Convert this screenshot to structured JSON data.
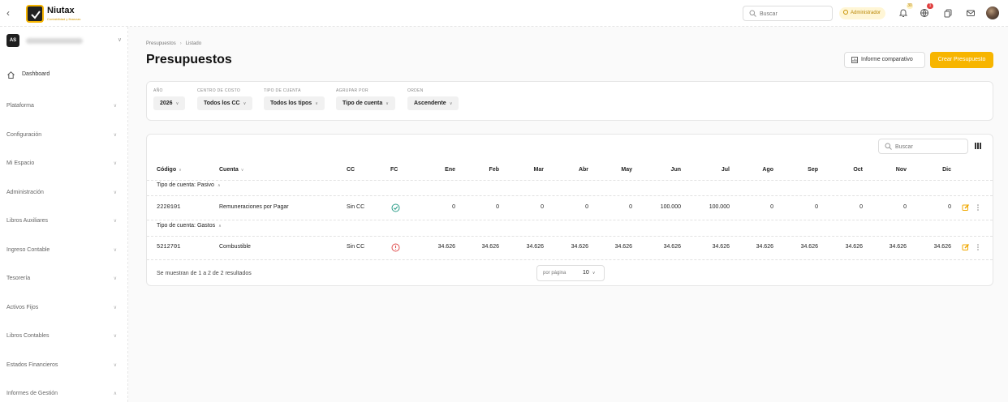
{
  "brand": {
    "name": "Niutax",
    "tagline": "Contabilidad y finanzas"
  },
  "topbar": {
    "search_placeholder": "Buscar",
    "role": "Administrador",
    "notifications_count": "30",
    "alerts_count": "1"
  },
  "sidebar": {
    "company_abbr": "AS",
    "dashboard": "Dashboard",
    "items": [
      {
        "label": "Plataforma",
        "chevron": "∨"
      },
      {
        "label": "Configuración",
        "chevron": "∨"
      },
      {
        "label": "Mi Espacio",
        "chevron": "∨"
      },
      {
        "label": "Administración",
        "chevron": "∨"
      },
      {
        "label": "Libros Auxiliares",
        "chevron": "∨"
      },
      {
        "label": "Ingreso Contable",
        "chevron": "∨"
      },
      {
        "label": "Tesorería",
        "chevron": "∨"
      },
      {
        "label": "Activos Fijos",
        "chevron": "∨"
      },
      {
        "label": "Libros Contables",
        "chevron": "∨"
      },
      {
        "label": "Estados Financieros",
        "chevron": "∨"
      },
      {
        "label": "Informes de Gestión",
        "chevron": "∧"
      }
    ]
  },
  "breadcrumb": {
    "parent": "Presupuestos",
    "current": "Listado"
  },
  "page": {
    "title": "Presupuestos",
    "informe_btn": "Informe comparativo",
    "crear_btn": "Crear Presupuesto"
  },
  "filters": [
    {
      "label": "AÑO",
      "value": "2026"
    },
    {
      "label": "CENTRO DE COSTO",
      "value": "Todos los CC"
    },
    {
      "label": "TIPO DE CUENTA",
      "value": "Todos los tipos"
    },
    {
      "label": "AGRUPAR POR",
      "value": "Tipo de cuenta"
    },
    {
      "label": "ORDEN",
      "value": "Ascendente"
    }
  ],
  "table": {
    "search_placeholder": "Buscar",
    "headers": {
      "codigo": "Código",
      "cuenta": "Cuenta",
      "cc": "CC",
      "fc": "FC",
      "months": [
        "Ene",
        "Feb",
        "Mar",
        "Abr",
        "May",
        "Jun",
        "Jul",
        "Ago",
        "Sep",
        "Oct",
        "Nov",
        "Dic"
      ]
    },
    "groups": [
      {
        "label": "Tipo de cuenta: Pasivo",
        "rows": [
          {
            "codigo": "2220101",
            "cuenta": "Remuneraciones por Pagar",
            "cc": "Sin CC",
            "fc": "ok",
            "months": [
              "0",
              "0",
              "0",
              "0",
              "0",
              "100.000",
              "100.000",
              "0",
              "0",
              "0",
              "0",
              "0"
            ]
          }
        ]
      },
      {
        "label": "Tipo de cuenta: Gastos",
        "rows": [
          {
            "codigo": "5212701",
            "cuenta": "Combustible",
            "cc": "Sin CC",
            "fc": "error",
            "months": [
              "34.626",
              "34.626",
              "34.626",
              "34.626",
              "34.626",
              "34.626",
              "34.626",
              "34.626",
              "34.626",
              "34.626",
              "34.626",
              "34.626"
            ]
          }
        ]
      }
    ],
    "footer": "Se muestran de 1 a 2 de 2 resultados",
    "per_page_label": "por página",
    "per_page_value": "10"
  },
  "colors": {
    "accent": "#f7b500",
    "ok": "#2e9e8a",
    "error": "#e05050"
  }
}
